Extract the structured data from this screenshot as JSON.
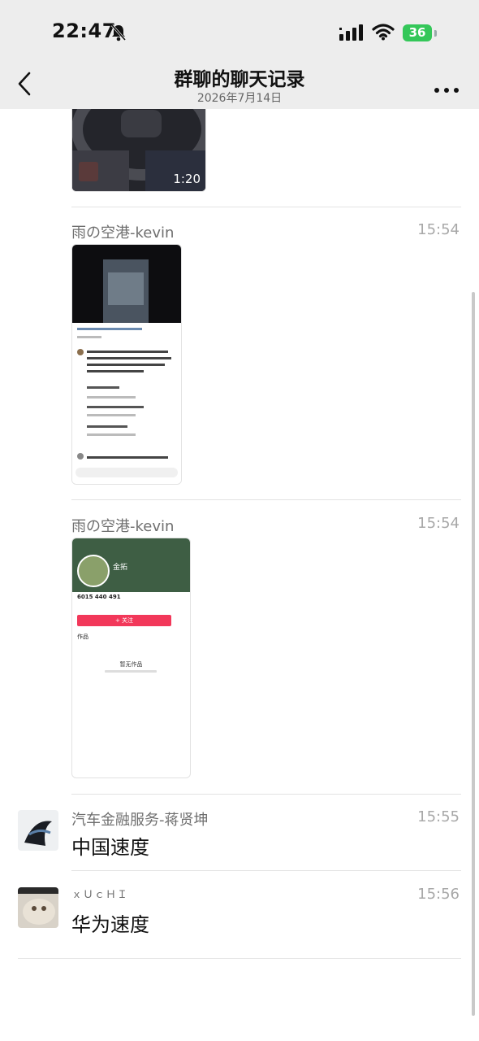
{
  "status": {
    "time": "22:47",
    "battery": "36"
  },
  "header": {
    "title": "群聊的聊天记录",
    "date": "2026年7月14日"
  },
  "messages": [
    {
      "type": "video",
      "duration": "1:20"
    },
    {
      "type": "image",
      "sender": "雨の空港-kevin",
      "time": "15:54"
    },
    {
      "type": "image",
      "sender": "雨の空港-kevin",
      "time": "15:54",
      "profile": {
        "name": "金拓",
        "stats": "6015  440  491",
        "follow": "+ 关注",
        "tab": "作品",
        "empty": "暂无作品"
      }
    },
    {
      "type": "text",
      "sender": "汽车金融服务-蒋贤坤",
      "time": "15:55",
      "text": "中国速度"
    },
    {
      "type": "text",
      "sender": "ｘＵｃＨＩ",
      "time": "15:56",
      "text": "华为速度"
    }
  ]
}
